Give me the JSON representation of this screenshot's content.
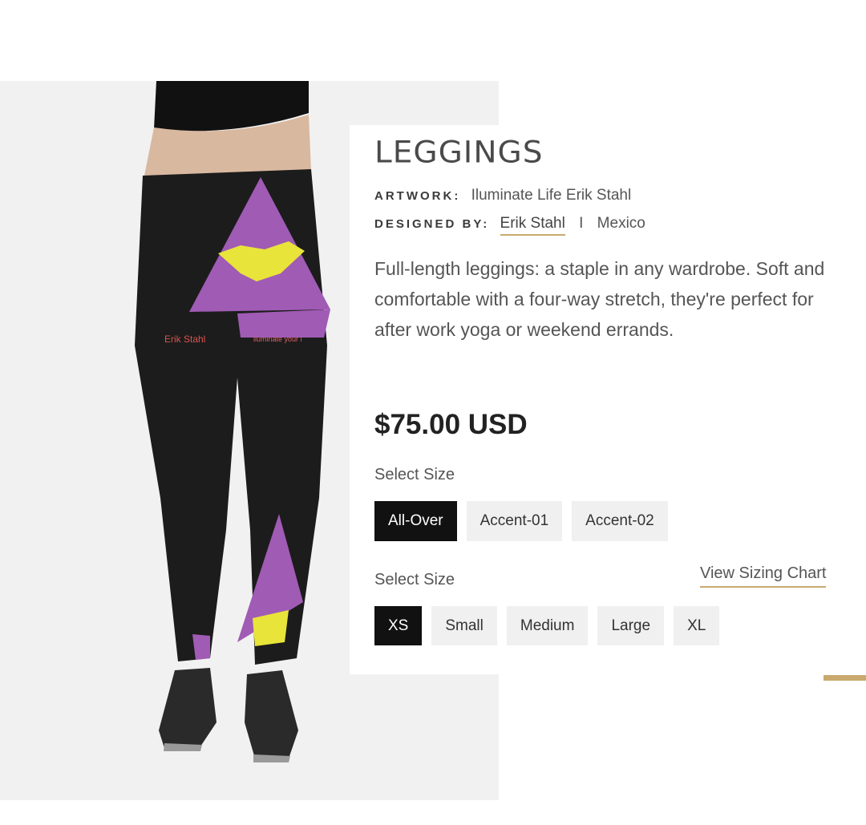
{
  "product": {
    "title": "LEGGINGS",
    "artwork_label": "ARTWORK:",
    "artwork_value": "Iluminate Life Erik Stahl",
    "designed_label": "DESIGNED BY:",
    "designer_name": "Erik Stahl",
    "separator": "I",
    "location": "Mexico",
    "description": "Full-length leggings: a staple in any wardrobe. Soft and comfortable with a four-way stretch, they're perfect for after work yoga or weekend errands.",
    "price": "$75.00 USD"
  },
  "style_selector": {
    "label": "Select Size",
    "options": [
      "All-Over",
      "Accent-01",
      "Accent-02"
    ],
    "selected": "All-Over"
  },
  "size_selector": {
    "label": "Select Size",
    "chart_link": "View Sizing Chart",
    "options": [
      "XS",
      "Small",
      "Medium",
      "Large",
      "XL"
    ],
    "selected": "XS"
  },
  "image": {
    "print_text_left": "Erik Stahl",
    "print_text_right": "iluminate your l",
    "colors": {
      "fabric": "#1c1c1c",
      "triangle": "#a05bb5",
      "splash": "#e8e43a",
      "accent": "#c9a96e"
    }
  }
}
